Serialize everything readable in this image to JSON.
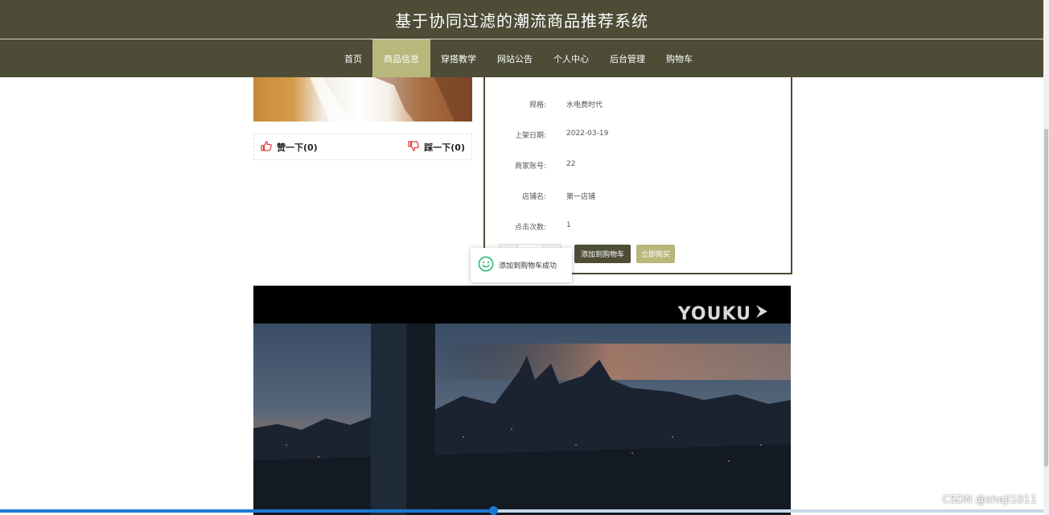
{
  "header": {
    "site_title": "基于协同过滤的潮流商品推荐系统"
  },
  "nav": {
    "items": [
      {
        "label": "首页"
      },
      {
        "label": "商品信息",
        "active": true
      },
      {
        "label": "穿搭教学"
      },
      {
        "label": "网站公告"
      },
      {
        "label": "个人中心"
      },
      {
        "label": "后台管理"
      },
      {
        "label": "购物车"
      }
    ]
  },
  "product": {
    "like_label": "赞一下(0)",
    "dislike_label": "踩一下(0)",
    "details": [
      {
        "label": "规格:",
        "value": "水电费时代"
      },
      {
        "label": "上架日期:",
        "value": "2022-03-19"
      },
      {
        "label": "商家账号:",
        "value": "22"
      },
      {
        "label": "店铺名:",
        "value": "第一店铺"
      },
      {
        "label": "点击次数:",
        "value": "1"
      }
    ],
    "add_to_cart_label": "添加到购物车",
    "buy_now_label": "立即购买"
  },
  "toast": {
    "message": "添加到购物车成功"
  },
  "video": {
    "logo_text": "YOUKU",
    "progress": 0.47
  },
  "watermark": "CSDN @sheji1011",
  "colors": {
    "header_bg": "#4c4c37",
    "accent": "#b8b77c",
    "progress": "#1a7ad0",
    "vote_icon": "#e03c3c",
    "toast_icon": "#2fb67d"
  },
  "icons": [
    "thumbs-up-icon",
    "thumbs-down-icon",
    "smile-icon",
    "youku-play-icon"
  ]
}
